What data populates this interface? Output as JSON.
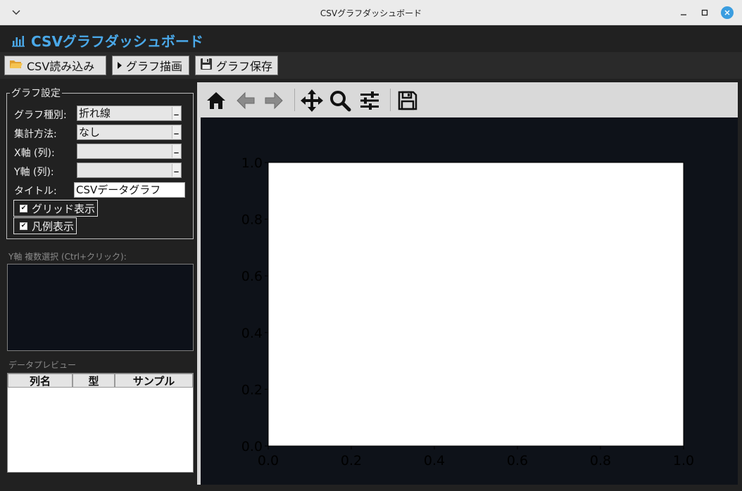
{
  "window": {
    "title": "CSVグラフダッシュボード",
    "menu_icon": "chevron-down-icon",
    "minimize_icon": "minimize-icon",
    "maximize_icon": "maximize-icon",
    "close_icon": "close-icon",
    "close_color": "#3a9de0"
  },
  "app": {
    "title": "CSVグラフダッシュボード",
    "title_icon": "bar-chart-icon",
    "title_color": "#4aa8e8"
  },
  "toolbar": {
    "open_label": "CSV読み込み",
    "open_icon": "folder-open-icon",
    "draw_label": "グラフ描画",
    "draw_icon": "play-triangle-icon",
    "save_label": "グラフ保存",
    "save_icon": "floppy-disk-icon"
  },
  "settings": {
    "legend": "グラフ設定",
    "graph_type_label": "グラフ種別:",
    "graph_type_value": "折れ線",
    "aggregate_label": "集計方法:",
    "aggregate_value": "なし",
    "x_axis_label": "X軸 (列):",
    "x_axis_value": "",
    "y_axis_label": "Y軸 (列):",
    "y_axis_value": "",
    "title_label": "タイトル:",
    "title_value": "CSVデータグラフ",
    "grid_label": "グリッド表示",
    "grid_checked": true,
    "legend_label": "凡例表示",
    "legend_checked": true
  },
  "multi_select": {
    "label": "Y軸 複数選択 (Ctrl+クリック):",
    "items": []
  },
  "preview": {
    "label": "データプレビュー",
    "columns": [
      "列名",
      "型",
      "サンプル"
    ],
    "rows": []
  },
  "plot_toolbar": {
    "icons": [
      "home-icon",
      "back-arrow-icon",
      "forward-arrow-icon",
      "pan-icon",
      "zoom-icon",
      "configure-subplots-icon",
      "save-figure-icon"
    ]
  },
  "chart_data": {
    "type": "line",
    "series": [],
    "title": "",
    "xlabel": "",
    "ylabel": "",
    "xlim": [
      0.0,
      1.0
    ],
    "ylim": [
      0.0,
      1.0
    ],
    "xticks": [
      "0.0",
      "0.2",
      "0.4",
      "0.6",
      "0.8",
      "1.0"
    ],
    "yticks": [
      "0.0",
      "0.2",
      "0.4",
      "0.6",
      "0.8",
      "1.0"
    ],
    "grid": false,
    "axes_facecolor": "#ffffff",
    "figure_facecolor": "#0e1219",
    "tick_color": "#000000"
  }
}
